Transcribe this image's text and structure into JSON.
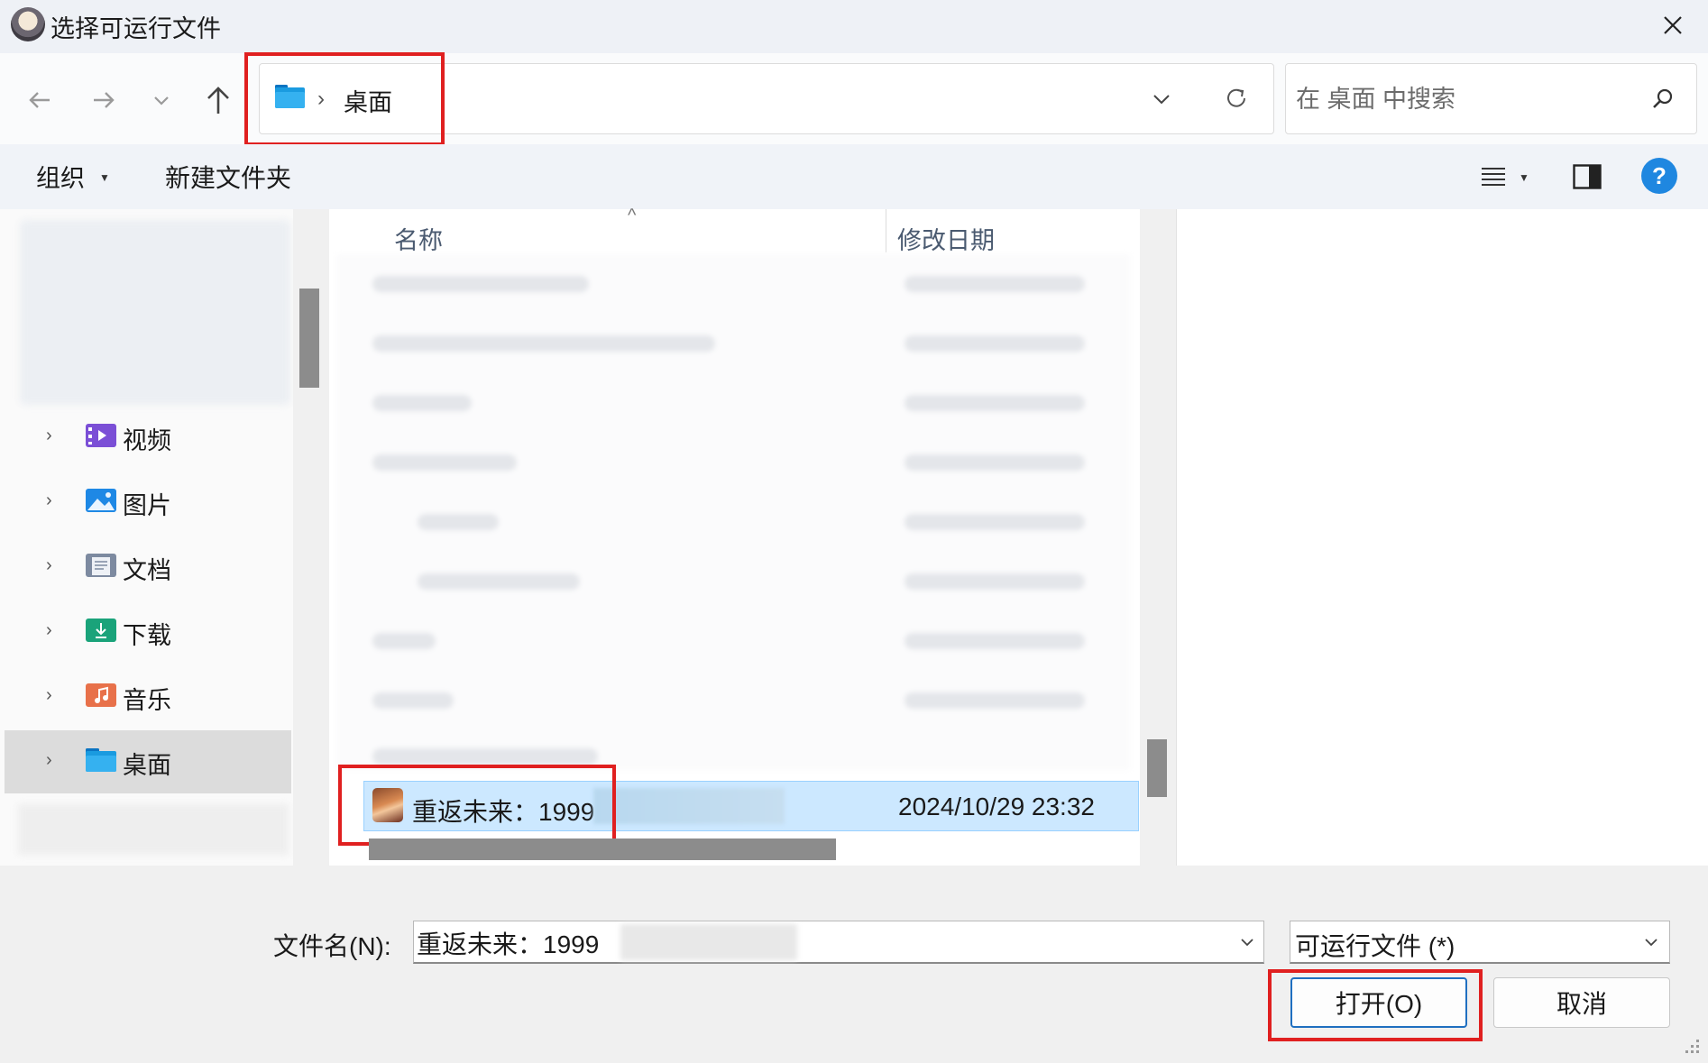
{
  "window": {
    "title": "选择可运行文件",
    "app_icon": "game-avatar-icon",
    "close_icon": "close-icon"
  },
  "address": {
    "folder_icon": "desktop-folder-icon",
    "separator": "›",
    "current": "桌面"
  },
  "search": {
    "placeholder": "在 桌面 中搜索"
  },
  "toolbar": {
    "organize": "组织",
    "new_folder": "新建文件夹",
    "help": "?"
  },
  "nav": {
    "items": [
      {
        "label": "视频",
        "icon": "videos-folder-icon",
        "color": "#7b4fd6"
      },
      {
        "label": "图片",
        "icon": "pictures-folder-icon",
        "color": "#1e88e5"
      },
      {
        "label": "文档",
        "icon": "documents-folder-icon",
        "color": "#7d8aa0"
      },
      {
        "label": "下载",
        "icon": "downloads-folder-icon",
        "color": "#1aa37a"
      },
      {
        "label": "音乐",
        "icon": "music-folder-icon",
        "color": "#e8714a"
      },
      {
        "label": "桌面",
        "icon": "desktop-folder-icon",
        "color": "#1a9be0",
        "active": true
      }
    ]
  },
  "filelist": {
    "columns": {
      "name": "名称",
      "modified": "修改日期"
    },
    "selected": {
      "name": "重返未来：1999",
      "modified": "2024/10/29 23:32"
    }
  },
  "bottom": {
    "filename_label": "文件名(N):",
    "filename_value": "重返未来：1999",
    "filetype": "可运行文件 (*)",
    "open": "打开(O)",
    "cancel": "取消"
  },
  "colors": {
    "highlight": "#e02020",
    "selection": "#cce8ff",
    "accent": "#1f87e0"
  }
}
